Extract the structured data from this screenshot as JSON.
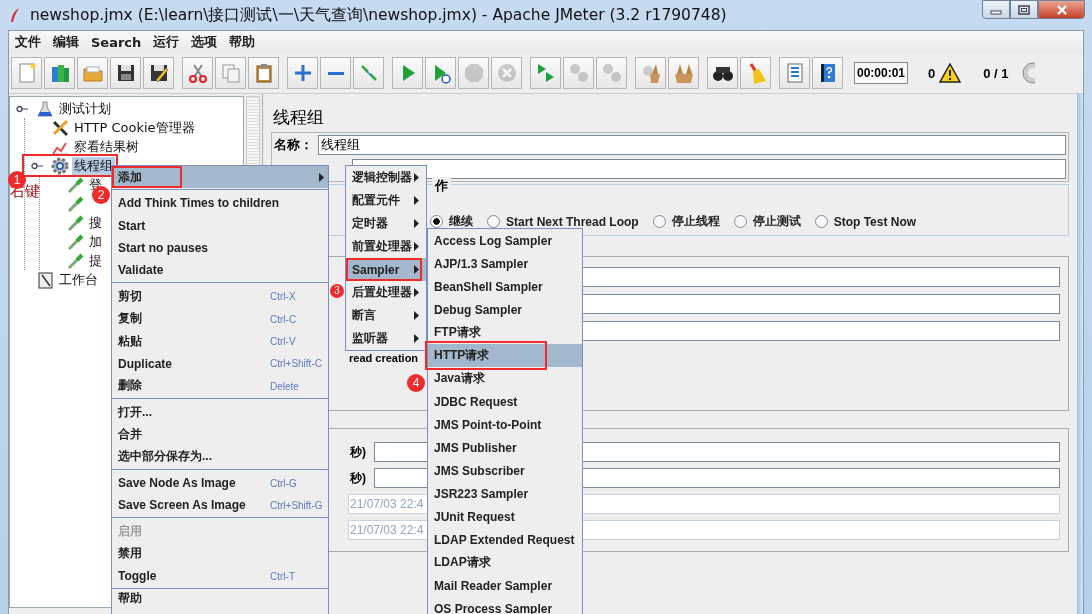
{
  "window": {
    "title": "newshop.jmx (E:\\learn\\接口测试\\一\\天气查询\\newshop.jmx) - Apache JMeter (3.2 r1790748)"
  },
  "menu_bar": [
    "文件",
    "编辑",
    "Search",
    "运行",
    "选项",
    "帮助"
  ],
  "toolbar": {
    "groups": [
      {
        "buttons": [
          {
            "kind": "new",
            "disabled": false
          },
          {
            "kind": "templates",
            "disabled": false
          },
          {
            "kind": "open",
            "disabled": false
          },
          {
            "kind": "save",
            "disabled": false
          },
          {
            "kind": "save-as",
            "disabled": false
          }
        ]
      },
      {
        "buttons": [
          {
            "kind": "cut",
            "disabled": false
          },
          {
            "kind": "copy",
            "disabled": false
          },
          {
            "kind": "paste",
            "disabled": false
          }
        ]
      },
      {
        "buttons": [
          {
            "kind": "expand",
            "disabled": false
          },
          {
            "kind": "collapse",
            "disabled": false
          },
          {
            "kind": "toggle",
            "disabled": false
          }
        ]
      },
      {
        "buttons": [
          {
            "kind": "start",
            "disabled": false
          },
          {
            "kind": "start-no-pause",
            "disabled": false
          },
          {
            "kind": "stop",
            "disabled": true
          },
          {
            "kind": "shutdown",
            "disabled": true
          }
        ]
      },
      {
        "buttons": [
          {
            "kind": "remote-start",
            "disabled": false
          },
          {
            "kind": "remote-stop",
            "disabled": true
          },
          {
            "kind": "remote-shutdown",
            "disabled": true
          }
        ]
      },
      {
        "buttons": [
          {
            "kind": "clear",
            "disabled": false
          },
          {
            "kind": "clear-all",
            "disabled": false
          }
        ]
      },
      {
        "buttons": [
          {
            "kind": "search",
            "disabled": false
          },
          {
            "kind": "reset",
            "disabled": false
          }
        ]
      },
      {
        "buttons": [
          {
            "kind": "functions",
            "disabled": false
          },
          {
            "kind": "help",
            "disabled": false
          }
        ]
      }
    ],
    "timer": "00:00:01",
    "error_count": "0",
    "threads": "0 / 1"
  },
  "tree": [
    {
      "label": "测试计划",
      "kind": "plan",
      "selected": false,
      "children": [
        {
          "label": "HTTP Cookie管理器",
          "kind": "config",
          "selected": false
        },
        {
          "label": "察看结果树",
          "kind": "listener",
          "selected": false
        },
        {
          "label": "线程组",
          "kind": "thread-group",
          "selected": true,
          "marker": "1",
          "note": "右键",
          "children": [
            {
              "label": "登",
              "kind": "sampler",
              "selected": false
            },
            {
              "kind": "sampler",
              "selected": false
            },
            {
              "label": "搜",
              "kind": "sampler",
              "selected": false
            },
            {
              "label": "加",
              "kind": "sampler",
              "selected": false
            },
            {
              "label": "提",
              "kind": "sampler",
              "selected": false
            }
          ]
        }
      ]
    },
    {
      "label": "工作台",
      "kind": "workbench",
      "selected": false
    }
  ],
  "editor": {
    "title": "线程组",
    "name_label": "名称：",
    "name_value": "线程组",
    "error_action": {
      "legend": "作",
      "options": [
        {
          "label": "继续",
          "selected": true
        },
        {
          "label": "Start Next Thread Loop",
          "selected": false
        },
        {
          "label": "停止线程",
          "selected": false
        },
        {
          "label": "停止测试",
          "selected": false
        },
        {
          "label": "Stop Test Now",
          "selected": false
        }
      ]
    },
    "thread_note": "read creation",
    "scheduler": {
      "duration_label": "秒)",
      "delay_label": "秒)",
      "start_time": "21/07/03 22:4",
      "end_time": "21/07/03 22:4"
    }
  },
  "context_menu": {
    "groups": [
      [
        {
          "label": "添加",
          "submenu": true,
          "selected": true,
          "marker": "2"
        }
      ],
      [
        {
          "label": "Add Think Times to children",
          "selected": false
        },
        {
          "label": "Start",
          "selected": false
        },
        {
          "label": "Start no pauses",
          "selected": false
        },
        {
          "label": "Validate",
          "selected": false
        }
      ],
      [
        {
          "label": "剪切",
          "shortcut": "Ctrl-X",
          "selected": false
        },
        {
          "label": "复制",
          "shortcut": "Ctrl-C",
          "selected": false
        },
        {
          "label": "粘贴",
          "shortcut": "Ctrl-V",
          "selected": false
        },
        {
          "label": "Duplicate",
          "shortcut": "Ctrl+Shift-C",
          "selected": false
        },
        {
          "label": "删除",
          "shortcut": "Delete",
          "selected": false
        }
      ],
      [
        {
          "label": "打开...",
          "selected": false
        },
        {
          "label": "合并",
          "selected": false
        },
        {
          "label": "选中部分保存为...",
          "selected": false
        }
      ],
      [
        {
          "label": "Save Node As Image",
          "shortcut": "Ctrl-G",
          "selected": false
        },
        {
          "label": "Save Screen As Image",
          "shortcut": "Ctrl+Shift-G",
          "selected": false
        }
      ],
      [
        {
          "label": "启用",
          "selected": false,
          "disabled": true
        },
        {
          "label": "禁用",
          "selected": false,
          "disabled": false
        },
        {
          "label": "Toggle",
          "shortcut": "Ctrl-T",
          "selected": false,
          "disabled": false
        }
      ],
      [
        {
          "label": "帮助",
          "selected": false
        }
      ]
    ]
  },
  "add_submenu": [
    {
      "label": "逻辑控制器",
      "selected": false
    },
    {
      "label": "配置元件",
      "selected": false
    },
    {
      "label": "定时器",
      "selected": false
    },
    {
      "label": "前置处理器",
      "selected": false
    },
    {
      "label": "Sampler",
      "selected": true,
      "marker": "3"
    },
    {
      "label": "后置处理器",
      "selected": false
    },
    {
      "label": "断言",
      "selected": false
    },
    {
      "label": "监听器",
      "selected": false
    }
  ],
  "sampler_submenu": [
    {
      "label": "Access Log Sampler",
      "selected": false
    },
    {
      "label": "AJP/1.3 Sampler",
      "selected": false
    },
    {
      "label": "BeanShell Sampler",
      "selected": false
    },
    {
      "label": "Debug Sampler",
      "selected": false
    },
    {
      "label": "FTP请求",
      "selected": false
    },
    {
      "label": "HTTP请求",
      "selected": true,
      "marker": "4"
    },
    {
      "label": "Java请求",
      "selected": false
    },
    {
      "label": "JDBC Request",
      "selected": false
    },
    {
      "label": "JMS Point-to-Point",
      "selected": false
    },
    {
      "label": "JMS Publisher",
      "selected": false
    },
    {
      "label": "JMS Subscriber",
      "selected": false
    },
    {
      "label": "JSR223 Sampler",
      "selected": false
    },
    {
      "label": "JUnit Request",
      "selected": false
    },
    {
      "label": "LDAP Extended Request",
      "selected": false
    },
    {
      "label": "LDAP请求",
      "selected": false
    },
    {
      "label": "Mail Reader Sampler",
      "selected": false
    },
    {
      "label": "OS Process Sampler",
      "selected": false
    }
  ]
}
